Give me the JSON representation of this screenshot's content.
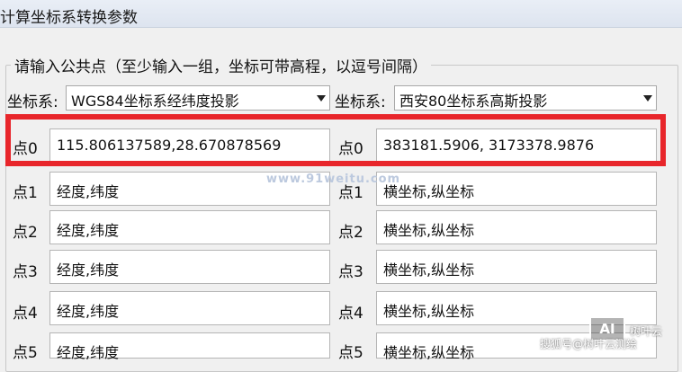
{
  "window": {
    "title": "计算坐标系转换参数"
  },
  "group": {
    "legend": "请输入公共点（至少输入一组，坐标可带高程，以逗号间隔）"
  },
  "left": {
    "coord_label": "坐标系:",
    "coord_value": "WGS84坐标系经纬度投影",
    "points": [
      {
        "label": "点0",
        "value": "115.806137589,28.670878569"
      },
      {
        "label": "点1",
        "value": "经度,纬度"
      },
      {
        "label": "点2",
        "value": "经度,纬度"
      },
      {
        "label": "点3",
        "value": "经度,纬度"
      },
      {
        "label": "点4",
        "value": "经度,纬度"
      },
      {
        "label": "点5",
        "value": "经度,纬度"
      }
    ]
  },
  "right": {
    "coord_label": "坐标系:",
    "coord_value": "西安80坐标系高斯投影",
    "points": [
      {
        "label": "点0",
        "value": "383181.5906, 3173378.9876"
      },
      {
        "label": "点1",
        "value": "横坐标,纵坐标"
      },
      {
        "label": "点2",
        "value": "横坐标,纵坐标"
      },
      {
        "label": "点3",
        "value": "横坐标,纵坐标"
      },
      {
        "label": "点4",
        "value": "横坐标,纵坐标"
      },
      {
        "label": "点5",
        "value": "横坐标,纵坐标"
      }
    ]
  },
  "watermarks": {
    "site": "www.91weitu.com",
    "logo": "AI",
    "brand": "树叶云",
    "sohu": "搜狐号@树叶云测绘"
  },
  "colors": {
    "highlight": "#e8262b",
    "field_bg": "#ffffff",
    "panel_bg": "#f0f0f0"
  }
}
